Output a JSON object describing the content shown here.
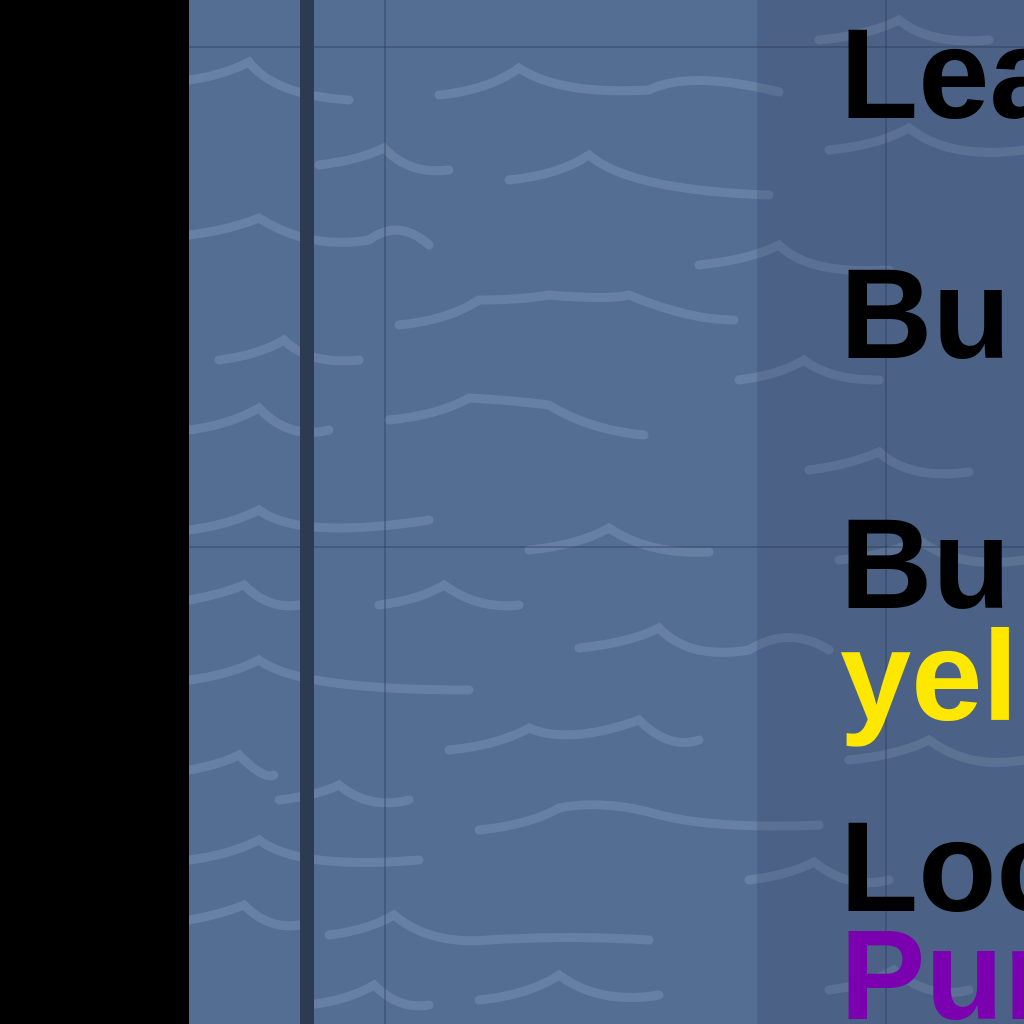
{
  "scene": {
    "background_color": "#000000",
    "water_color": "#546d93",
    "wave_color": "#6c84a8",
    "divider_color": "#2c3a52"
  },
  "status_list": [
    {
      "text": "Lea",
      "color": "#000000"
    },
    {
      "text": "Bu",
      "color": "#000000"
    },
    {
      "text": "Bu",
      "color": "#000000"
    },
    {
      "text": "yel",
      "color": "#ffe800"
    },
    {
      "text": "Loc",
      "color": "#000000"
    },
    {
      "text": "Pur",
      "color": "#7a00b0"
    }
  ]
}
